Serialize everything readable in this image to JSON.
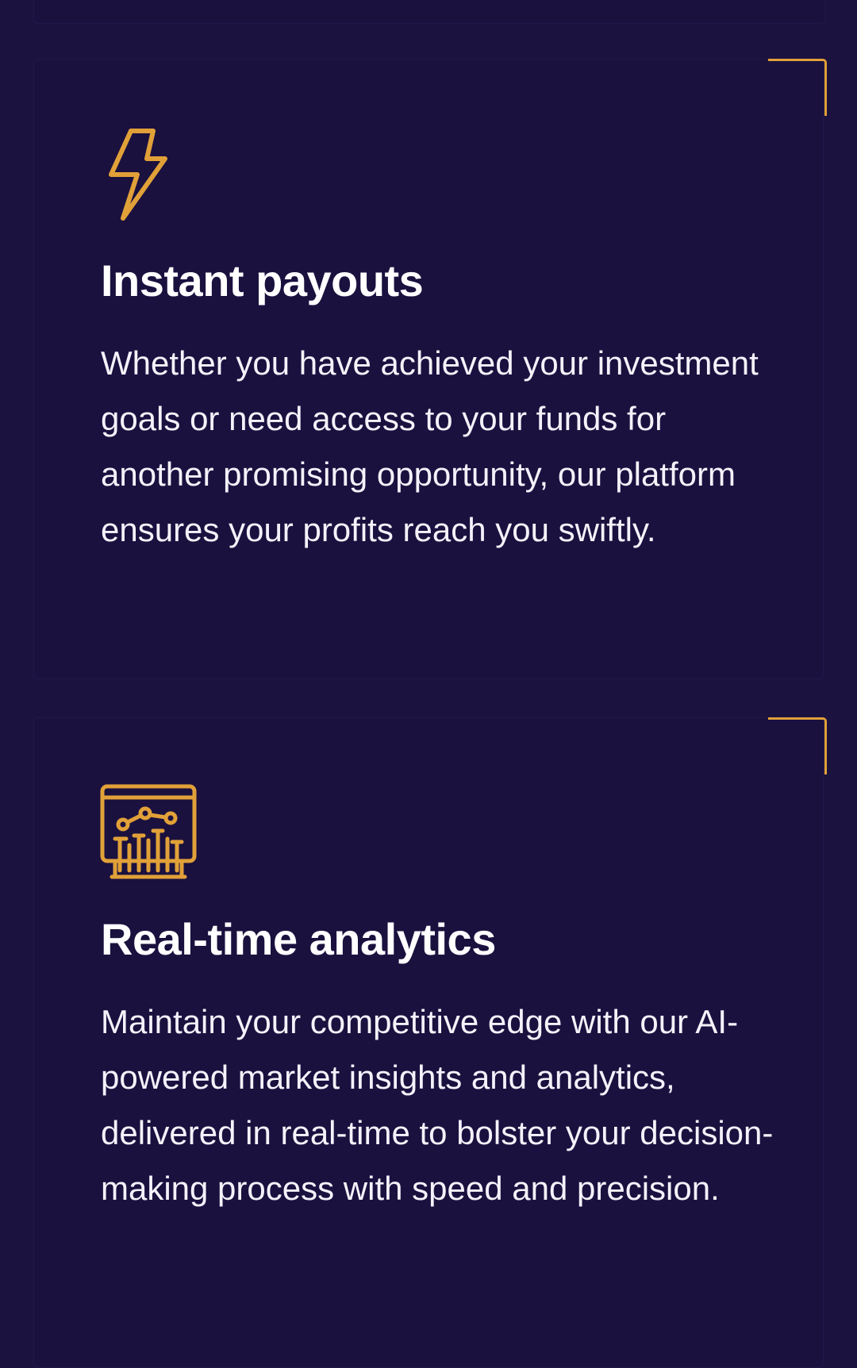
{
  "theme": {
    "background": "#1c1240",
    "card_background": "#1b113f",
    "accent": "#e1a138",
    "text": "#ffffff"
  },
  "features": [
    {
      "icon": "lightning-bolt-icon",
      "title": "Instant payouts",
      "description": "Whether you have achieved your investment goals or need access to your funds for another promising opportunity, our platform ensures your profits reach you swiftly."
    },
    {
      "icon": "analytics-dashboard-icon",
      "title": "Real-time analytics",
      "description": "Maintain your competitive edge with our AI-powered market insights and analytics, delivered in real-time to bolster your decision-making process with speed and precision."
    }
  ]
}
